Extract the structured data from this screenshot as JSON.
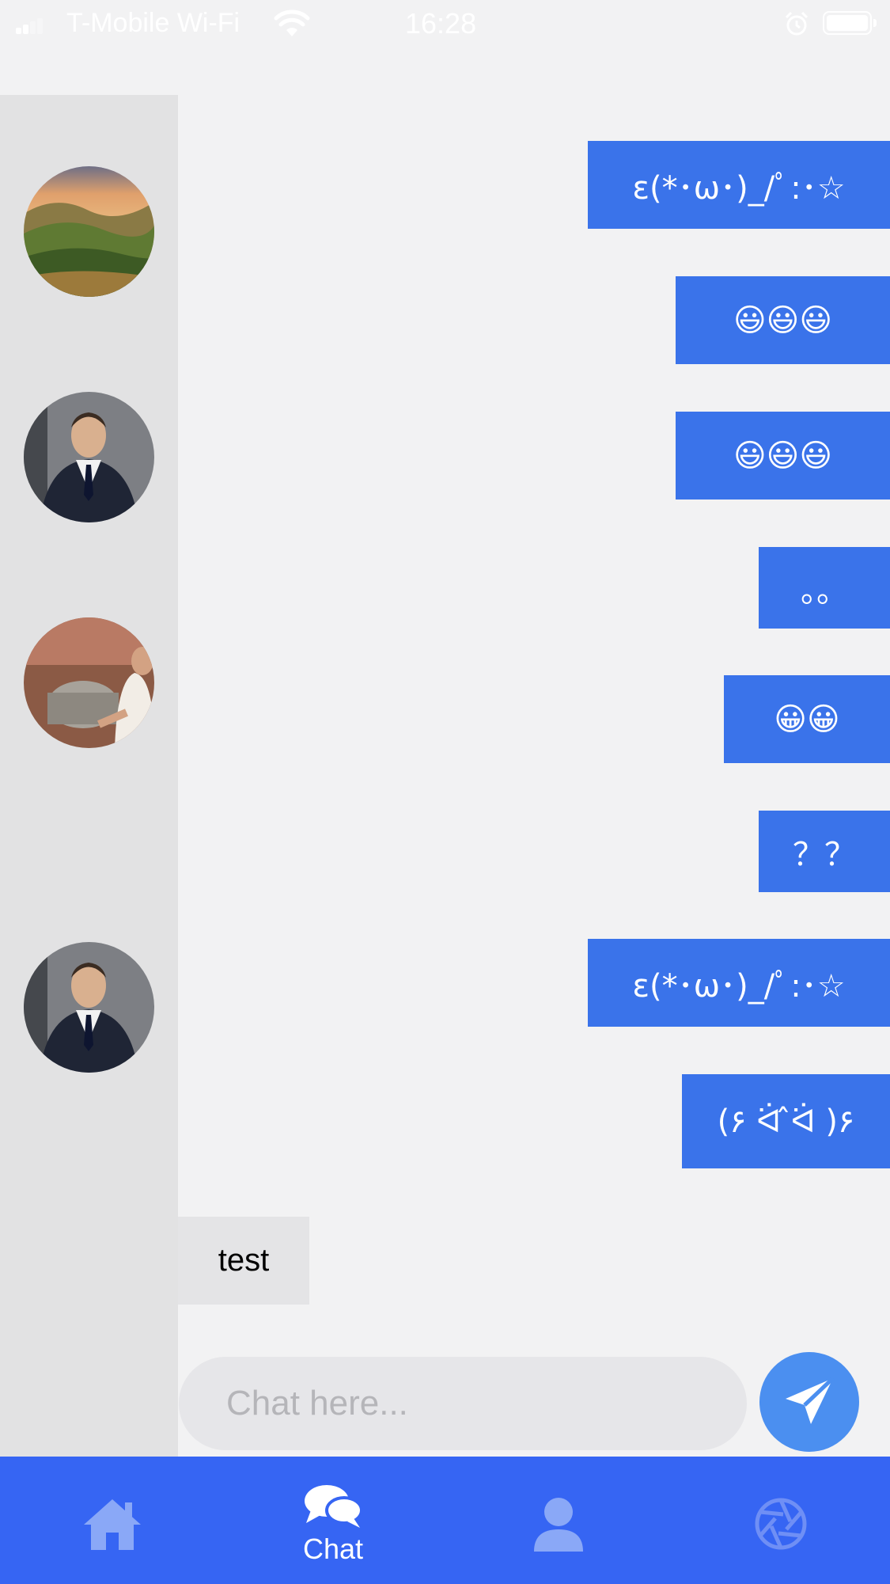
{
  "status_bar": {
    "carrier": "T-Mobile Wi-Fi",
    "time": "16:28",
    "battery_level": 1.0
  },
  "contacts": [
    {
      "name": "landscape-avatar",
      "icon": "landscape-photo"
    },
    {
      "name": "businessman-avatar",
      "icon": "person-suit-photo"
    },
    {
      "name": "chef-avatar",
      "icon": "chef-kitchen-photo"
    },
    {
      "name": "businessman-avatar-2",
      "icon": "person-suit-photo"
    }
  ],
  "messages": [
    {
      "direction": "outgoing",
      "text": "ε(*･ω･)_/ﾟ:･☆"
    },
    {
      "direction": "outgoing",
      "text": "😃😃😃"
    },
    {
      "direction": "outgoing",
      "text": "😃😃😃"
    },
    {
      "direction": "outgoing",
      "text": "。。"
    },
    {
      "direction": "outgoing",
      "text": "😀😀"
    },
    {
      "direction": "outgoing",
      "text": "？？"
    },
    {
      "direction": "outgoing",
      "text": "ε(*･ω･)_/ﾟ:･☆"
    },
    {
      "direction": "outgoing",
      "text": "(۶ ᐛ ̂ᐛ )۶"
    },
    {
      "direction": "incoming",
      "text": "test"
    }
  ],
  "input": {
    "placeholder": "Chat here...",
    "value": ""
  },
  "tabs": [
    {
      "label": "",
      "icon": "home-icon"
    },
    {
      "label": "Chat",
      "icon": "chat-bubbles-icon",
      "active": true
    },
    {
      "label": "",
      "icon": "person-icon"
    },
    {
      "label": "",
      "icon": "aperture-icon"
    }
  ],
  "colors": {
    "accent": "#3a73ea",
    "tabbar": "#3665f3",
    "send_button": "#4b8ff0",
    "background": "#f2f2f3",
    "sidebar": "#e2e2e3"
  }
}
